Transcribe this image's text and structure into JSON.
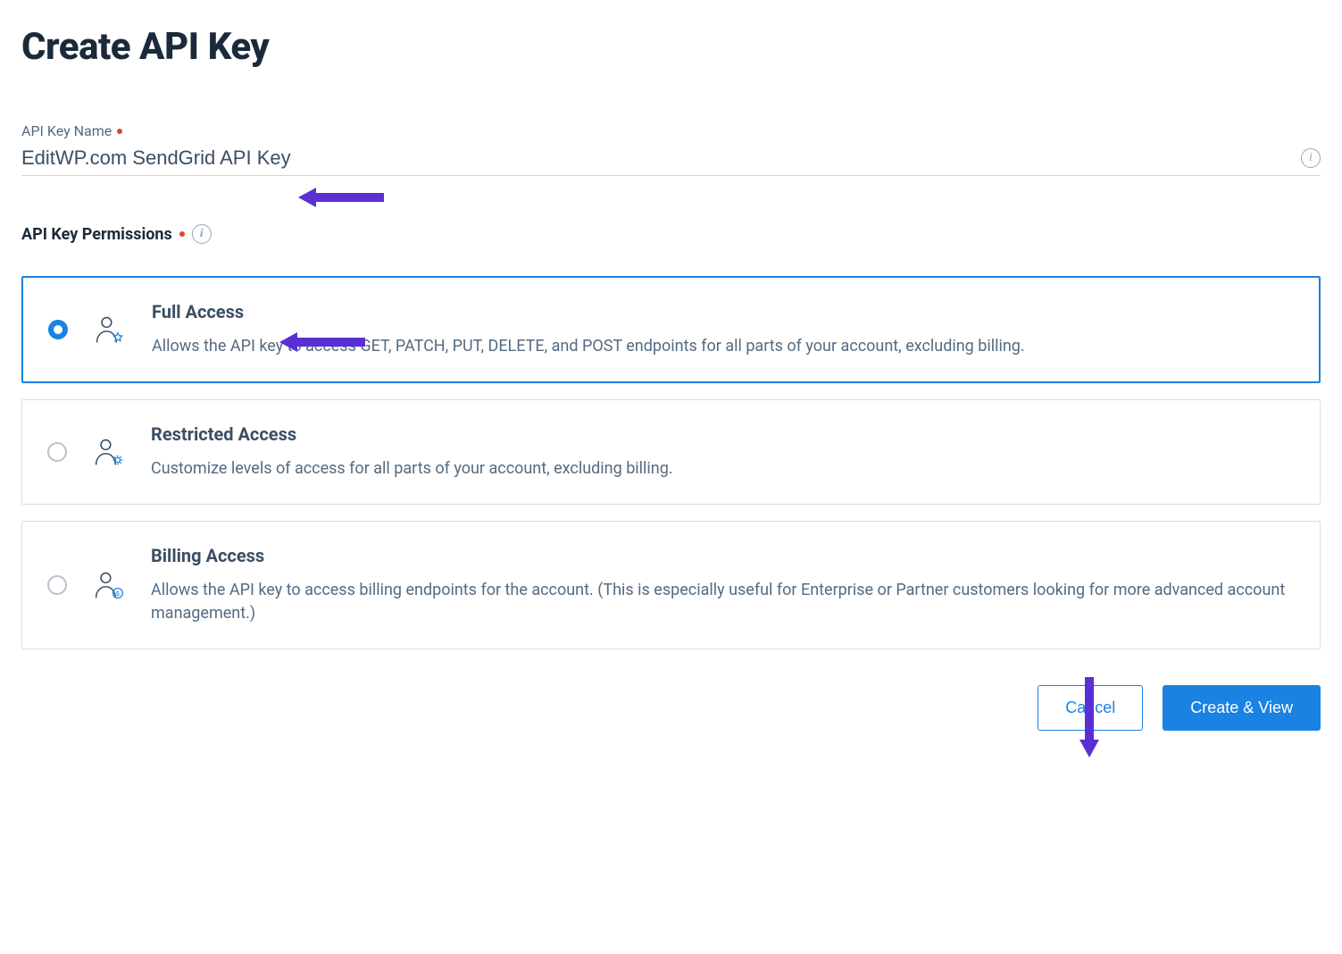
{
  "page": {
    "title": "Create API Key"
  },
  "nameField": {
    "label": "API Key Name",
    "value": "EditWP.com SendGrid API Key"
  },
  "permissions": {
    "label": "API Key Permissions",
    "options": [
      {
        "title": "Full Access",
        "desc": "Allows the API key to access GET, PATCH, PUT, DELETE, and POST endpoints for all parts of your account, excluding billing.",
        "selected": true
      },
      {
        "title": "Restricted Access",
        "desc": "Customize levels of access for all parts of your account, excluding billing.",
        "selected": false
      },
      {
        "title": "Billing Access",
        "desc": "Allows the API key to access billing endpoints for the account. (This is especially useful for Enterprise or Partner customers looking for more advanced account management.)",
        "selected": false
      }
    ]
  },
  "actions": {
    "cancel": "Cancel",
    "create": "Create & View"
  },
  "colors": {
    "primary": "#1a82e2",
    "annotation": "#5b2fd6",
    "required": "#e0452c"
  }
}
